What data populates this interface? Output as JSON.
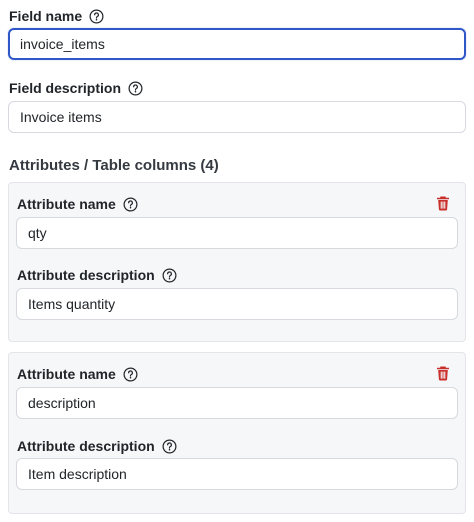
{
  "field": {
    "name_label": "Field name",
    "name_value": "invoice_items",
    "description_label": "Field description",
    "description_value": "Invoice items"
  },
  "attributes": {
    "title": "Attributes / Table columns (4)",
    "items": [
      {
        "name_label": "Attribute name",
        "name_value": "qty",
        "description_label": "Attribute description",
        "description_value": "Items quantity"
      },
      {
        "name_label": "Attribute name",
        "name_value": "description",
        "description_label": "Attribute description",
        "description_value": "Item description"
      }
    ]
  },
  "icons": {
    "help": "question-circle-icon",
    "delete": "trash-icon"
  },
  "colors": {
    "focus_border": "#2f57c7",
    "delete_icon": "#c9302c",
    "card_background": "#f6f7f9"
  }
}
